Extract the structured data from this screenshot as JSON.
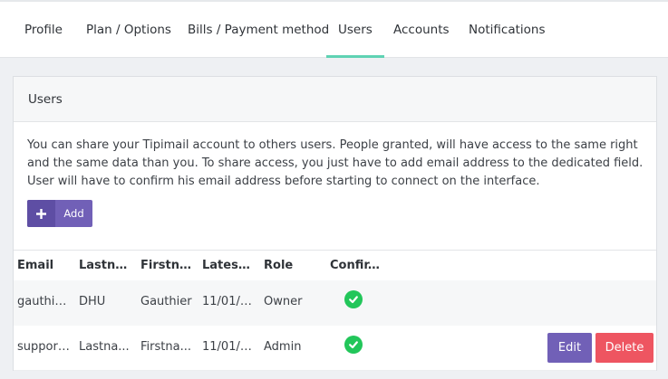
{
  "tabs": [
    {
      "label": "Profile"
    },
    {
      "label": "Plan / Options"
    },
    {
      "label": "Bills / Payment method"
    },
    {
      "label": "Users",
      "active": true
    },
    {
      "label": "Accounts"
    },
    {
      "label": "Notifications"
    }
  ],
  "panel": {
    "title": "Users",
    "intro": "You can share your Tipimail account to others users. People granted, will have access to the same right and the same data than you. To share access, you just have to add email address to the dedicated field. User will have to confirm his email address before starting to connect on the interface.",
    "add_label": "Add",
    "add_icon": "plus-icon"
  },
  "table": {
    "headers": [
      "Email",
      "Lastna...",
      "Firstna...",
      "Latest ...",
      "Role",
      "Confir..."
    ],
    "rows": [
      {
        "email": "gauthie...",
        "lastname": "DHU",
        "firstname": "Gauthier",
        "latest": "11/01/2...",
        "role": "Owner",
        "confirmed_icon": "check-circle-icon"
      },
      {
        "email": "support...",
        "lastname": "Lastna...",
        "firstname": "Firstna...",
        "latest": "11/01/2...",
        "role": "Admin",
        "confirmed_icon": "check-circle-icon",
        "edit_label": "Edit",
        "delete_label": "Delete"
      }
    ]
  },
  "colors": {
    "accent_tab": "#5fd2b3",
    "primary_button": "#7160b7",
    "danger_button": "#ee5561",
    "success_check": "#22c65a"
  }
}
